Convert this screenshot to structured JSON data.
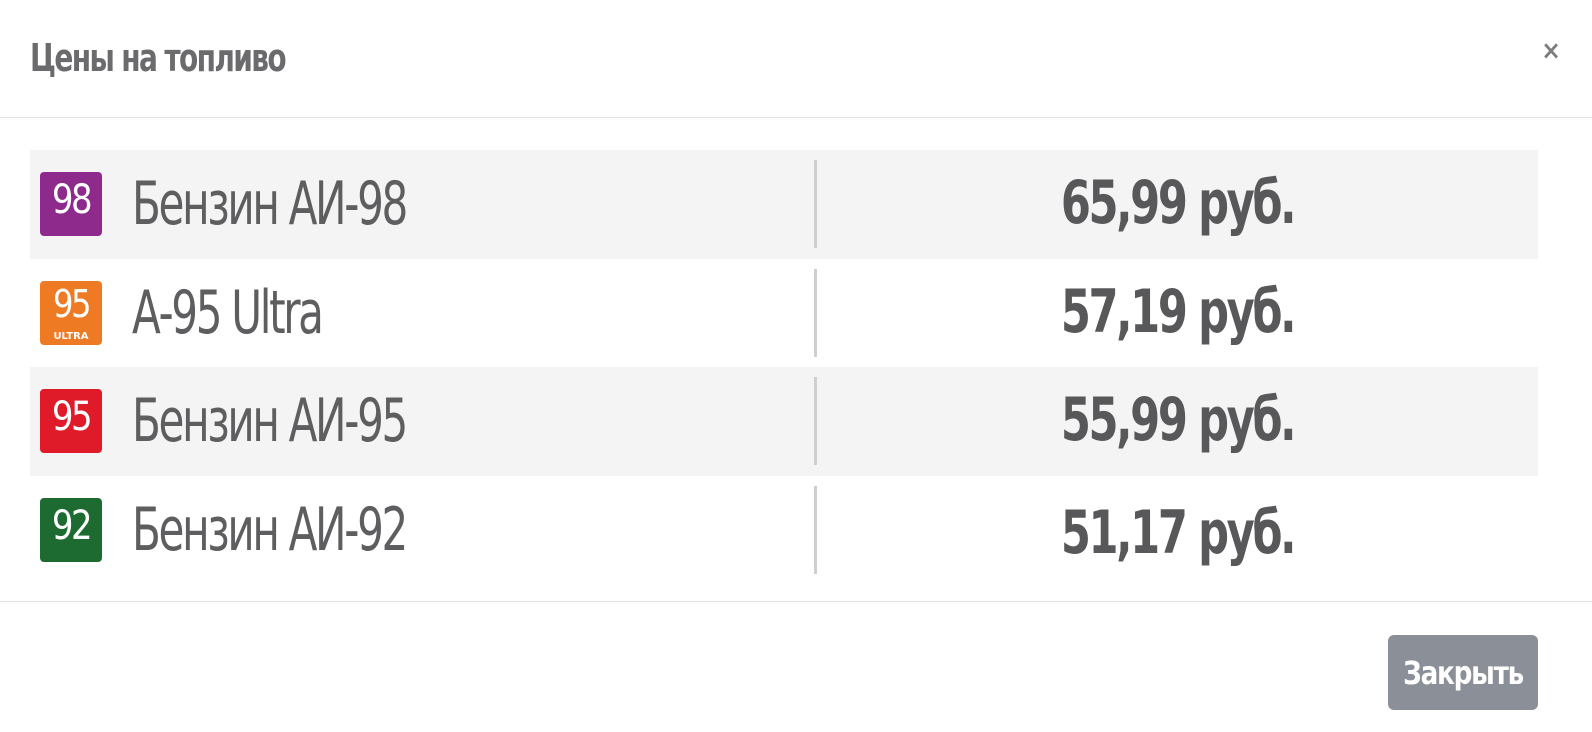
{
  "modal": {
    "title": "Цены на топливо",
    "close_icon": "×",
    "close_button_label": "Закрыть"
  },
  "fuels": [
    {
      "badge": "98",
      "badge_sub": "",
      "badge_color": "#8d2a8c",
      "name": "Бензин АИ-98",
      "price": "65,99 руб."
    },
    {
      "badge": "95",
      "badge_sub": "ULTRA",
      "badge_color": "#ee7b23",
      "name": "А-95 Ultra",
      "price": "57,19 руб."
    },
    {
      "badge": "95",
      "badge_sub": "",
      "badge_color": "#df1b2a",
      "name": "Бензин АИ-95",
      "price": "55,99 руб."
    },
    {
      "badge": "92",
      "badge_sub": "",
      "badge_color": "#1e6b32",
      "name": "Бензин АИ-92",
      "price": "51,17 руб."
    }
  ]
}
